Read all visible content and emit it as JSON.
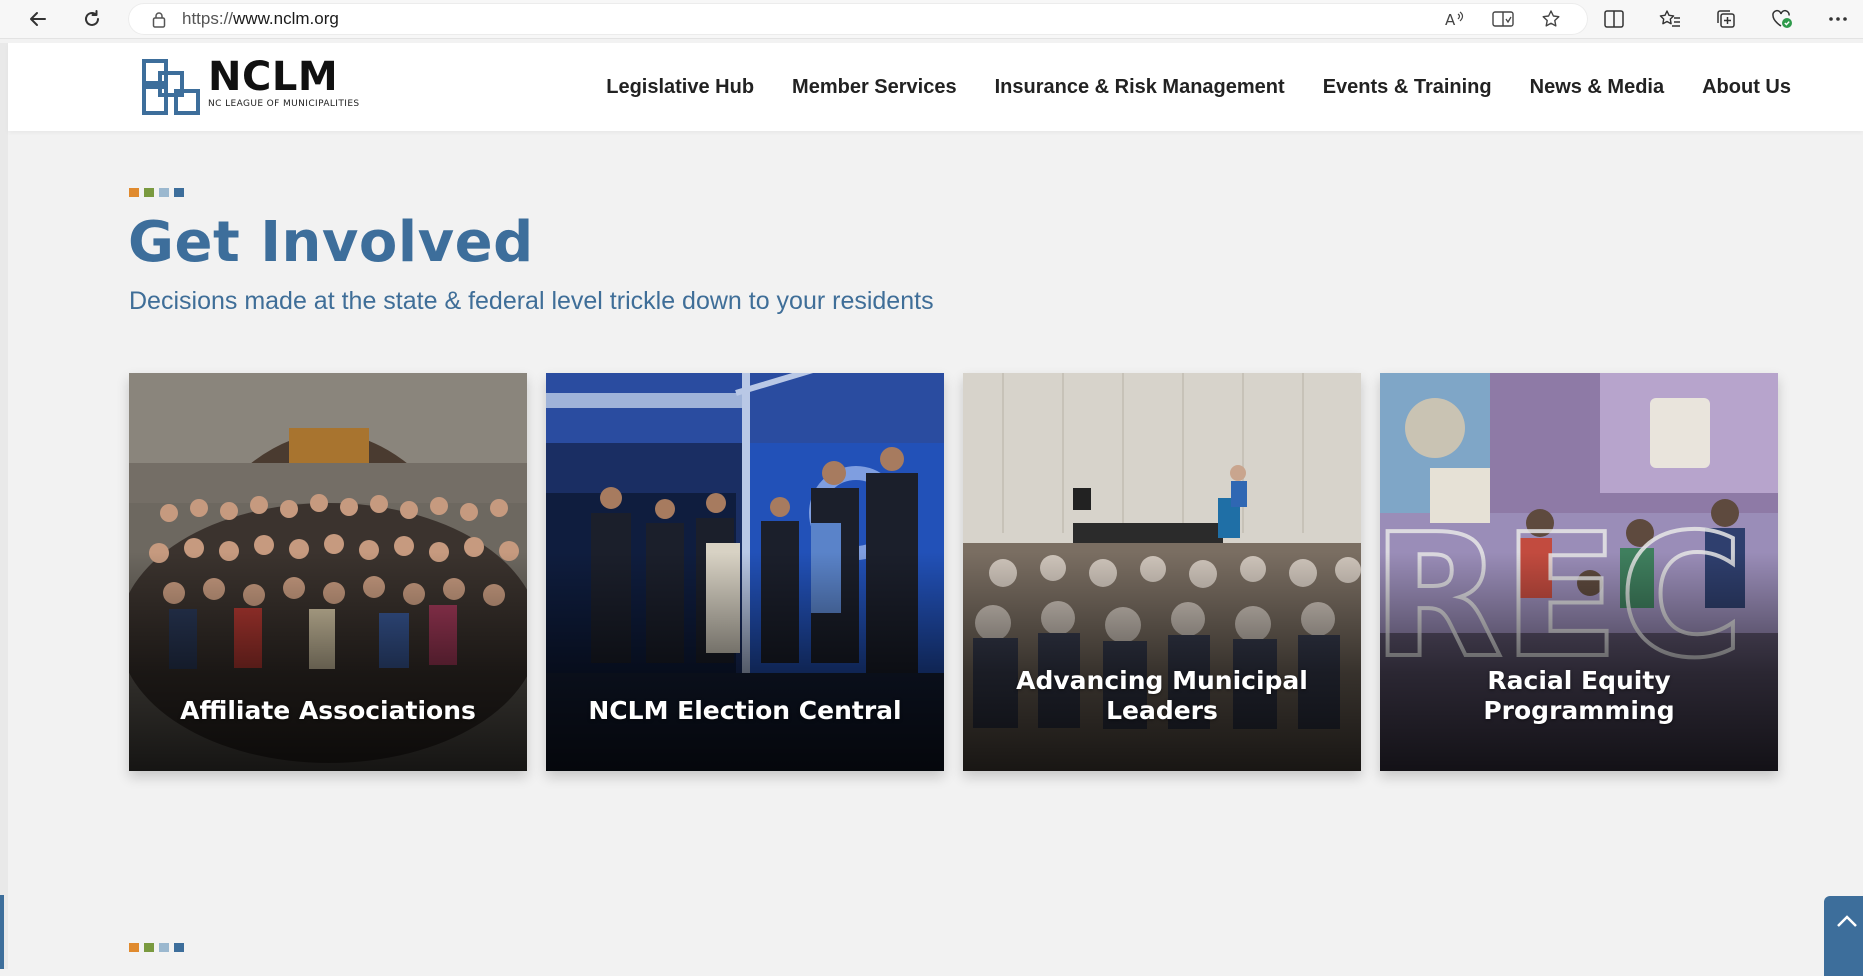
{
  "browser": {
    "url_scheme": "https://",
    "url_host": "www.nclm.org",
    "icons": [
      "back-icon",
      "reload-icon",
      "lock-icon",
      "read-aloud-icon",
      "immersive-reader-icon",
      "favorite-star-icon",
      "split-screen-icon",
      "favorites-icon",
      "collections-icon",
      "browser-essentials-icon",
      "more-icon"
    ]
  },
  "header": {
    "logo_name": "NCLM",
    "logo_sub": "NC LEAGUE OF MUNICIPALITIES",
    "nav": [
      {
        "label": "Legislative Hub"
      },
      {
        "label": "Member Services"
      },
      {
        "label": "Insurance & Risk Management"
      },
      {
        "label": "Events & Training"
      },
      {
        "label": "News & Media"
      },
      {
        "label": "About Us"
      }
    ]
  },
  "section": {
    "dots_colors": [
      "#e08a2e",
      "#7a9a3f",
      "#9bb8cf",
      "#3d6e9b"
    ],
    "title": "Get Involved",
    "subtitle": "Decisions made at the state & federal level trickle down to your residents"
  },
  "cards": [
    {
      "title": "Affiliate Associations"
    },
    {
      "title": "NCLM Election Central"
    },
    {
      "title": "Advancing Municipal Leaders"
    },
    {
      "title": "Racial Equity Programming",
      "overlay_text": "REC"
    }
  ],
  "colors": {
    "brand_blue": "#3d6e9b",
    "page_bg": "#f2f2f2"
  }
}
